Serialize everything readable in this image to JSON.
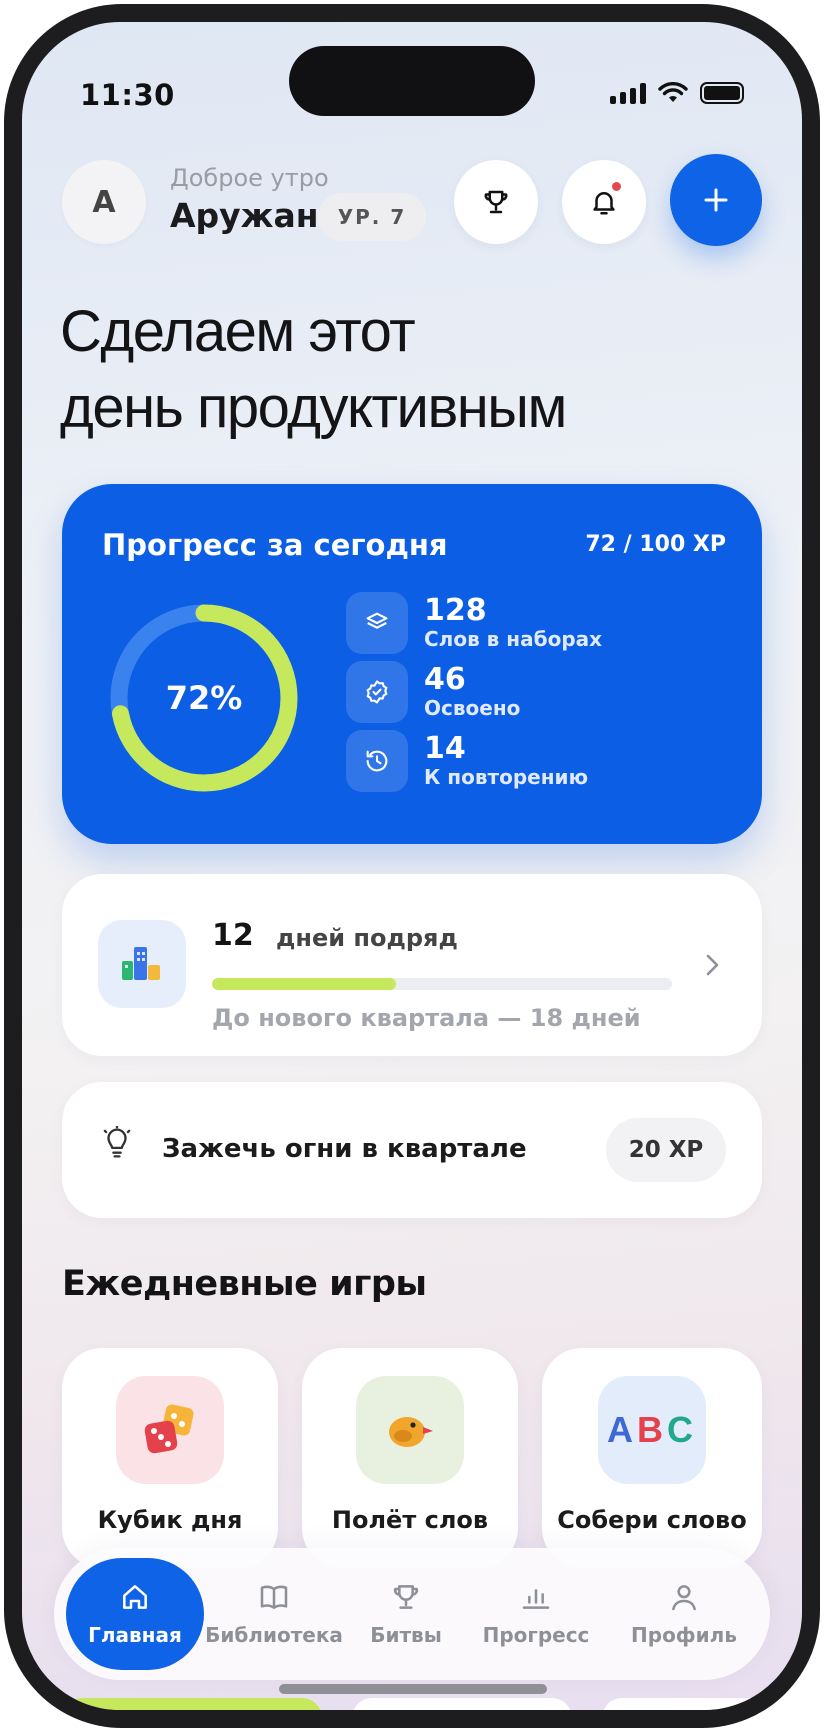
{
  "status_bar": {
    "time": "11:30"
  },
  "header": {
    "avatar_initial": "A",
    "greeting": "Доброе утро",
    "user_name": "Аружан",
    "level": "УР. 7",
    "icons": [
      "trophy-icon",
      "bell-icon",
      "plus-icon"
    ]
  },
  "headline": {
    "line1": "Сделаем этот",
    "line2": "день продуктивным"
  },
  "progress_card": {
    "title": "Прогресс за сегодня",
    "xp": "72 / 100 XP",
    "percent_label": "72%",
    "percent": 0.72,
    "stats": [
      {
        "value": "128",
        "label": "Слов в наборах",
        "icon": "layers-icon"
      },
      {
        "value": "46",
        "label": "Освоено",
        "icon": "badge-check-icon"
      },
      {
        "value": "14",
        "label": "К повторению",
        "icon": "history-icon"
      }
    ],
    "colors": {
      "card": "#0c5fe4",
      "ring": "#c6e85c"
    }
  },
  "streak": {
    "count": "12",
    "label": "дней подряд",
    "progress": 0.4,
    "subtitle": "До нового квартала — 18 дней",
    "icon": "city-blocks-icon"
  },
  "task": {
    "label": "Зажечь огни в квартале",
    "xp": "20 XP",
    "icon": "lightbulb-icon"
  },
  "daily_games": {
    "title": "Ежедневные игры",
    "items": [
      {
        "label": "Кубик дня",
        "icon": "dice-icon"
      },
      {
        "label": "Полёт слов",
        "icon": "bird-icon"
      },
      {
        "label": "Собери слово",
        "letters": [
          "A",
          "B",
          "C"
        ]
      }
    ]
  },
  "tab_bar": {
    "items": [
      {
        "label": "Главная",
        "icon": "home-icon",
        "active": true
      },
      {
        "label": "Библиотека",
        "icon": "book-icon"
      },
      {
        "label": "Битвы",
        "icon": "trophy-icon"
      },
      {
        "label": "Прогресс",
        "icon": "bar-chart-icon"
      },
      {
        "label": "Профиль",
        "icon": "user-icon"
      }
    ]
  }
}
